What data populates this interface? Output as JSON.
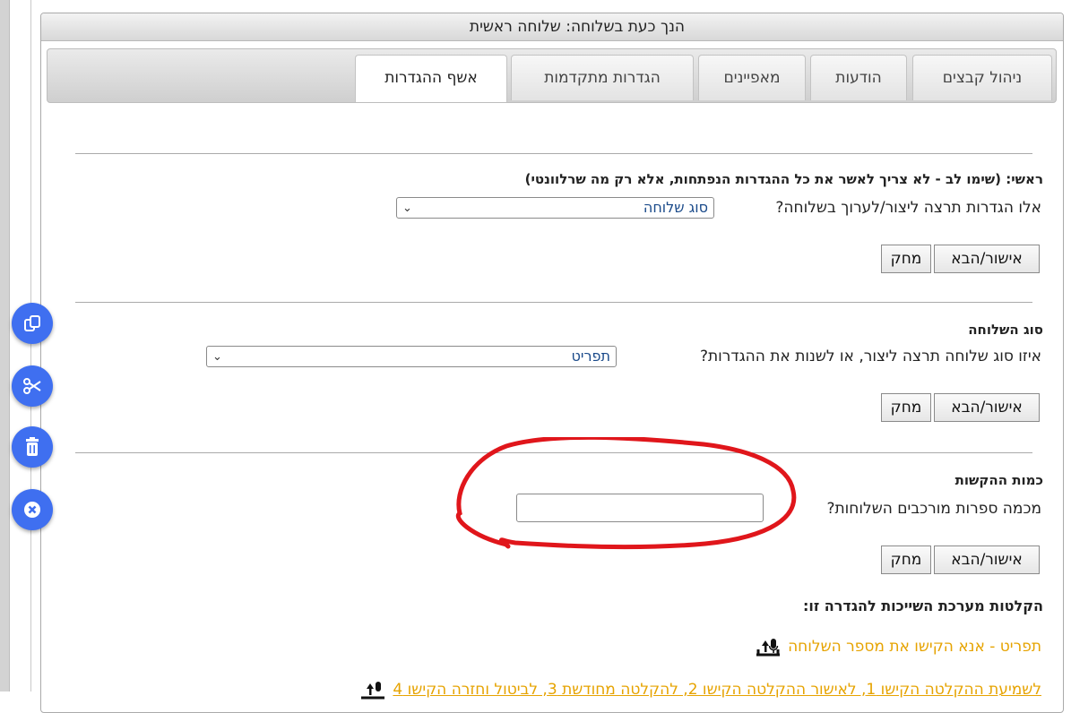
{
  "panel": {
    "title": "הנך כעת בשלוחה: שלוחה ראשית"
  },
  "tabs": [
    {
      "label": "ניהול קבצים",
      "active": false
    },
    {
      "label": "הודעות",
      "active": false
    },
    {
      "label": "מאפיינים",
      "active": false
    },
    {
      "label": "הגדרות מתקדמות",
      "active": false
    },
    {
      "label": "אשף ההגדרות",
      "active": true
    }
  ],
  "section_main": {
    "heading": "ראשי: (שימו לב - לא צריך לאשר את כל ההגדרות הנפתחות, אלא רק מה שרלוונטי)",
    "question": "אלו הגדרות תרצה ליצור/לערוך בשלוחה?",
    "select_value": "סוג שלוחה"
  },
  "section_type": {
    "heading": "סוג השלוחה",
    "question": "איזו סוג שלוחה תרצה ליצור, או לשנות את ההגדרות?",
    "select_value": "תפריט"
  },
  "section_digits": {
    "heading": "כמות ההקשות",
    "question": "מכמה ספרות מורכבים השלוחות?",
    "input_value": ""
  },
  "buttons": {
    "confirm_label": "אישור/הבא",
    "delete_label": "מחק"
  },
  "recordings": {
    "heading": "הקלטות מערכת השייכות להגדרה זו:",
    "link1": "תפריט - אנא הקישו את מספר השלוחה",
    "link2": "לשמיעת ההקלטה הקישו 1, לאישור ההקלטה הקישו 2, להקלטה מחודשת 3, לביטול וחזרה הקישו 4"
  },
  "side_buttons": [
    {
      "icon": "copy-icon"
    },
    {
      "icon": "scissors-icon"
    },
    {
      "icon": "trash-icon"
    },
    {
      "icon": "close-circle-icon"
    }
  ],
  "colors": {
    "accent_blue": "#3f6ff0",
    "link_orange": "#e6a300",
    "select_text": "#1a4a8a",
    "annotation_red": "#e0161b"
  }
}
